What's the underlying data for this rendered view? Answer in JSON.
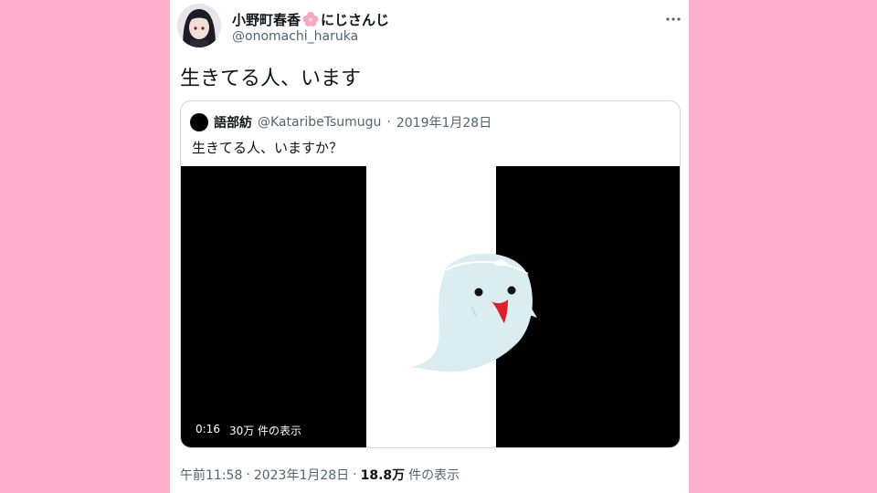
{
  "author": {
    "display_name": "小野町春香",
    "name_suffix": "にじさんじ",
    "handle": "@onomachi_haruka"
  },
  "tweet": {
    "text": "生きてる人、います",
    "time": "午前11:58",
    "date": "2023年1月28日",
    "views_count": "18.8万",
    "views_label": "件の表示"
  },
  "quote": {
    "author_name": "語部紡",
    "author_handle": "@KataribeTsumugu",
    "separator": "·",
    "date": "2019年1月28日",
    "text": "生きてる人、いますか？",
    "video": {
      "duration": "0:16",
      "views": "30万 件の表示"
    }
  },
  "colors": {
    "background": "#ffaecb",
    "card": "#ffffff",
    "secondary_text": "#536471",
    "primary_text": "#0f1419",
    "ghost_body": "#dbedf1",
    "ghost_tongue": "#d9202b"
  },
  "icons": [
    "more-icon",
    "sakura-icon",
    "ghost-illustration"
  ]
}
